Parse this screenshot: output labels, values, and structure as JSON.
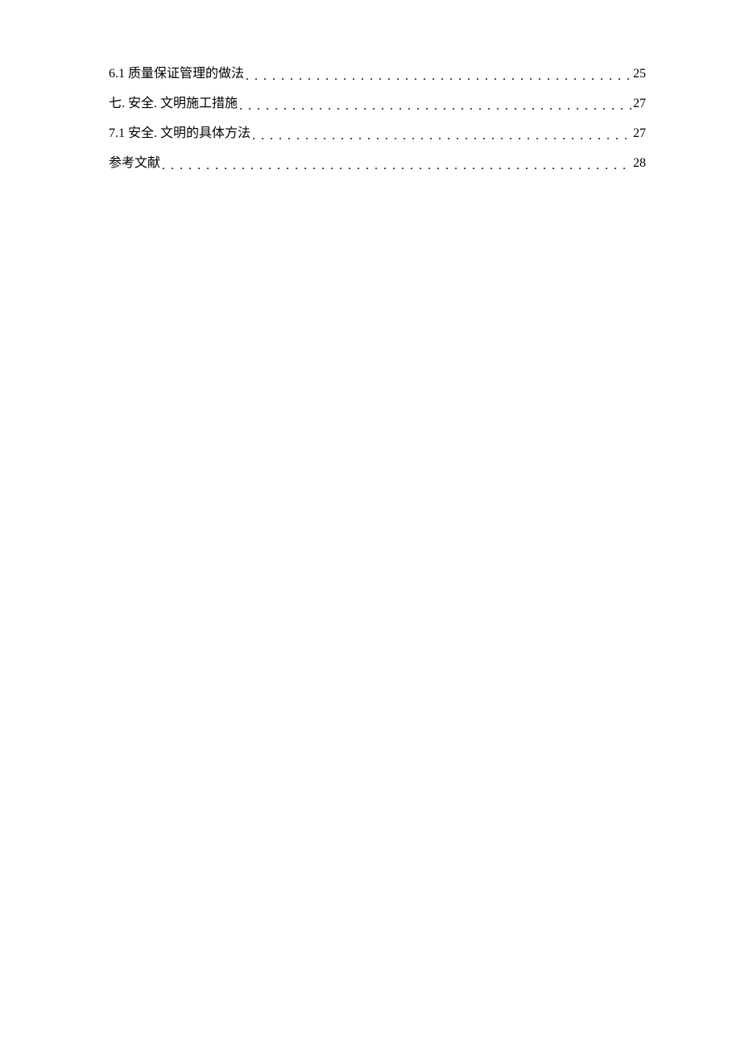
{
  "toc": {
    "entries": [
      {
        "title": "6.1 质量保证管理的做法",
        "page": "25"
      },
      {
        "title": "七. 安全. 文明施工措施",
        "page": "27"
      },
      {
        "title": "7.1 安全. 文明的具体方法",
        "page": "27"
      },
      {
        "title": "参考文献",
        "page": "28"
      }
    ],
    "dots": ". . . . . . . . . . . . . . . . . . . . . . . . . . . . . . . . . . . . . . . . . . . . . . . . . . . . . . . . . . . . . . . . . . . . . . . . . . . . . . . . . . . . . . . . . . . . . . . . . . . . . . . . . . . . . . . . . . . . . . . . . ."
  }
}
